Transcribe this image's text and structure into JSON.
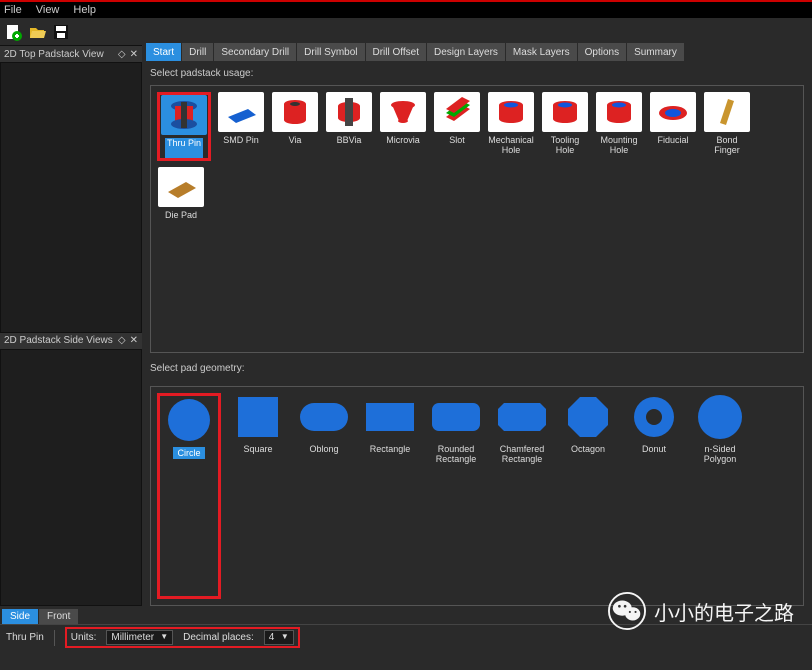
{
  "menu": {
    "file": "File",
    "view": "View",
    "help": "Help"
  },
  "panels": {
    "top": "2D Top Padstack View",
    "side": "2D Padstack Side Views"
  },
  "tabs": [
    "Start",
    "Drill",
    "Secondary Drill",
    "Drill Symbol",
    "Drill Offset",
    "Design Layers",
    "Mask Layers",
    "Options",
    "Summary"
  ],
  "section": {
    "usage": "Select padstack usage:",
    "geom": "Select pad geometry:"
  },
  "usage": [
    {
      "label": "Thru Pin",
      "sel": true
    },
    {
      "label": "SMD Pin"
    },
    {
      "label": "Via"
    },
    {
      "label": "BBVia"
    },
    {
      "label": "Microvia"
    },
    {
      "label": "Slot"
    },
    {
      "label": "Mechanical Hole"
    },
    {
      "label": "Tooling Hole"
    },
    {
      "label": "Mounting Hole"
    },
    {
      "label": "Fiducial"
    },
    {
      "label": "Bond Finger"
    },
    {
      "label": "Die Pad"
    }
  ],
  "geom": [
    {
      "label": "Circle",
      "sel": true
    },
    {
      "label": "Square"
    },
    {
      "label": "Oblong"
    },
    {
      "label": "Rectangle"
    },
    {
      "label": "Rounded Rectangle"
    },
    {
      "label": "Chamfered Rectangle"
    },
    {
      "label": "Octagon"
    },
    {
      "label": "Donut"
    },
    {
      "label": "n-Sided Polygon"
    }
  ],
  "bottom_tabs": {
    "side": "Side",
    "front": "Front"
  },
  "status": {
    "type": "Thru Pin",
    "units_label": "Units:",
    "units_value": "Millimeter",
    "dec_label": "Decimal places:",
    "dec_value": "4"
  },
  "watermark": "小小的电子之路"
}
